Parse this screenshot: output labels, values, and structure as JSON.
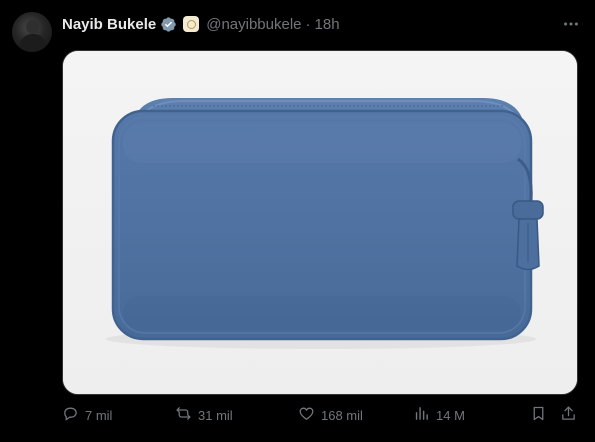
{
  "post": {
    "author_name": "Nayib Bukele",
    "handle": "@nayibbukele",
    "separator": "·",
    "time": "18h"
  },
  "media": {
    "description_hidden": ""
  },
  "actions": {
    "replies": "7 mil",
    "reposts": "31 mil",
    "likes": "168 mil",
    "views": "14 M"
  },
  "icons": {
    "verified": "verified-badge-icon",
    "affiliate": "affiliate-badge-icon",
    "more": "more-icon",
    "reply": "reply-icon",
    "repost": "repost-icon",
    "like": "heart-icon",
    "views": "views-icon",
    "bookmark": "bookmark-icon",
    "share": "share-icon"
  },
  "colors": {
    "background": "#000000",
    "text": "#e7e9ea",
    "muted": "#71767b",
    "verified": "#829aab",
    "pouch": "#4f73a3"
  }
}
